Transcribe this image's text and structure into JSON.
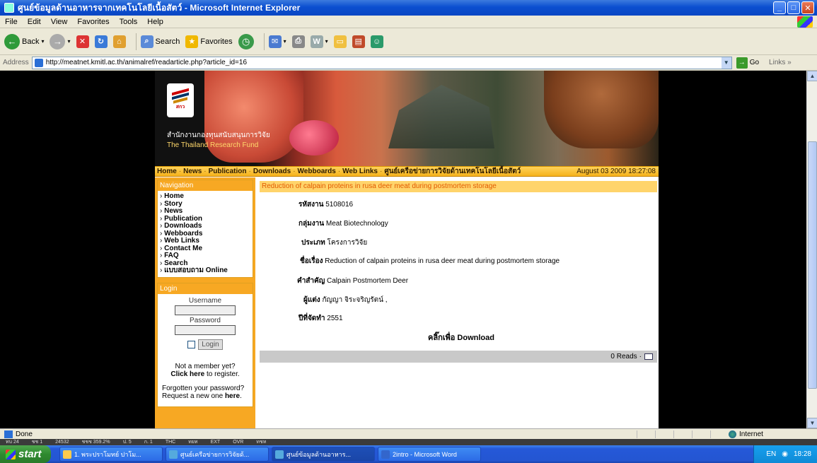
{
  "window": {
    "title": "ศูนย์ข้อมูลด้านอาหารจากเทคโนโลยีเนื้อสัตว์ - Microsoft Internet Explorer"
  },
  "menu": [
    "File",
    "Edit",
    "View",
    "Favorites",
    "Tools",
    "Help"
  ],
  "toolbar": {
    "back": "Back",
    "search": "Search",
    "favorites": "Favorites"
  },
  "address": {
    "label": "Address",
    "url": "http://meatnet.kmitl.ac.th/animalref/readarticle.php?article_id=16",
    "go": "Go",
    "links": "Links"
  },
  "banner": {
    "org_th": "สำนักงานกองทุนสนับสนุนการวิจัย",
    "org_en": "The Thailand Research Fund",
    "logo_text": "สกว"
  },
  "topnav": {
    "items": [
      "Home",
      "News",
      "Publication",
      "Downloads",
      "Webboards",
      "Web Links",
      "ศูนย์เครือข่ายการวิจัยด้านเทคโนโลยีเนื้อสัตว์"
    ],
    "date": "August 03 2009 18:27:08"
  },
  "navigation": {
    "title": "Navigation",
    "items": [
      "Home",
      "Story",
      "News",
      "Publication",
      "Downloads",
      "Webboards",
      "Web Links",
      "Contact Me",
      "FAQ",
      "Search",
      "แบบสอบถาม Online"
    ]
  },
  "login": {
    "title": "Login",
    "username_label": "Username",
    "password_label": "Password",
    "button": "Login",
    "not_member": "Not a member yet?",
    "click_here": "Click here",
    "to_register": " to register.",
    "forgot1": "Forgotten your password?",
    "forgot2": "Request a new one ",
    "here": "here",
    "period": "."
  },
  "article": {
    "title": "Reduction of calpain proteins in rusa deer meat during postmortem storage",
    "fields": [
      {
        "key": "รหัสงาน",
        "value": "5108016"
      },
      {
        "key": "กลุ่มงาน",
        "value": "Meat Biotechnology"
      },
      {
        "key": "ประเภท",
        "value": "โครงการวิจัย"
      },
      {
        "key": "ชื่อเรื่อง",
        "value": "Reduction of calpain proteins in rusa deer meat during postmortem storage"
      },
      {
        "key": "คำสำคัญ",
        "value": "Calpain Postmortem Deer"
      },
      {
        "key": "ผู้แต่ง",
        "value": "กัญญา จิระจริญรัตน์ ,"
      },
      {
        "key": "ปีที่จัดทำ",
        "value": "2551"
      }
    ],
    "download": "คลิ๊กเพื่อ Download",
    "reads": "0 Reads"
  },
  "status": {
    "text": "Done",
    "zone": "Internet"
  },
  "ime": [
    "ทบ 24",
    "ชช 1",
    "24532",
    "ชชช 359.2%",
    "ป. 5",
    "ก. 1",
    "THC",
    "ทยท",
    "EXT",
    "OVR",
    "ทชท"
  ],
  "taskbar": {
    "start": "start",
    "tasks": [
      "1. พระปราโมทย์ ปาโม...",
      "ศูนย์เครือข่ายการวิจัยด้...",
      "ศูนย์ข้อมูลด้านอาหาร...",
      "2intro - Microsoft Word"
    ],
    "lang": "EN",
    "clock": "18:28"
  }
}
